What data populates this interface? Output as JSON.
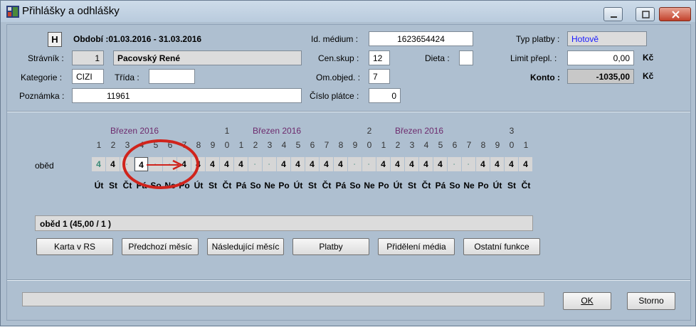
{
  "window": {
    "title": "Přihlášky a odhlášky"
  },
  "header": {
    "h_button": "H",
    "period": "Období :01.03.2016 - 31.03.2016",
    "stravnik_label": "Strávník :",
    "stravnik_id": "1",
    "stravnik_name": "Pacovský René",
    "kategorie_label": "Kategorie :",
    "kategorie_value": "CIZI",
    "trida_label": "Třída :",
    "trida_value": "",
    "poznamka_label": "Poznámka :",
    "poznamka_value": "11961",
    "id_medium_label": "Id. médium :",
    "id_medium_value": "1623654424",
    "censkup_label": "Cen.skup :",
    "censkup_value": "12",
    "dieta_label": "Dieta :",
    "dieta_value": "",
    "omobjed_label": "Om.objed. :",
    "omobjed_value": "7",
    "cislo_platce_label": "Číslo plátce :",
    "cislo_platce_value": "0",
    "typ_platby_label": "Typ platby :",
    "typ_platby_value": "Hotově",
    "limit_label": "Limit přepl. :",
    "limit_value": "0,00",
    "limit_unit": "Kč",
    "konto_label": "Konto :",
    "konto_value": "-1035,00",
    "konto_unit": "Kč"
  },
  "calendar": {
    "months": [
      "Březen 2016",
      "Březen 2016",
      "Březen 2016"
    ],
    "tens": [
      "1",
      "2",
      "3"
    ],
    "days_units": [
      "1",
      "2",
      "3",
      "4",
      "5",
      "6",
      "7",
      "8",
      "9",
      "0",
      "1",
      "2",
      "3",
      "4",
      "5",
      "6",
      "7",
      "8",
      "9",
      "0",
      "1",
      "2",
      "3",
      "4",
      "5",
      "6",
      "7",
      "8",
      "9",
      "0",
      "1"
    ],
    "weekdays": [
      "Út",
      "St",
      "Čt",
      "Pá",
      "So",
      "Ne",
      "Po",
      "Út",
      "St",
      "Čt",
      "Pá",
      "So",
      "Ne",
      "Po",
      "Út",
      "St",
      "Čt",
      "Pá",
      "So",
      "Ne",
      "Po",
      "Út",
      "St",
      "Čt",
      "Pá",
      "So",
      "Ne",
      "Po",
      "Út",
      "St",
      "Čt"
    ],
    "row_label": "oběd",
    "cells": [
      "4",
      "4",
      "",
      "4",
      "",
      "",
      "4",
      "4",
      "4",
      "4",
      "4",
      "",
      "",
      "4",
      "4",
      "4",
      "4",
      "4",
      "",
      "",
      "4",
      "4",
      "4",
      "4",
      "4",
      "",
      "",
      "4",
      "4",
      "4",
      "4"
    ]
  },
  "meal_info": "oběd 1  (45,00 / 1 )",
  "buttons": {
    "karta": "Karta v RS",
    "predchozi": "Předchozí měsíc",
    "nasledujici": "Následující měsíc",
    "platby": "Platby",
    "prideleni": "Přidělení média",
    "ostatni": "Ostatní funkce",
    "ok": "OK",
    "storno": "Storno"
  },
  "colors": {
    "accent_red": "#d0241c",
    "typ_platby_text": "#1a1aff"
  }
}
